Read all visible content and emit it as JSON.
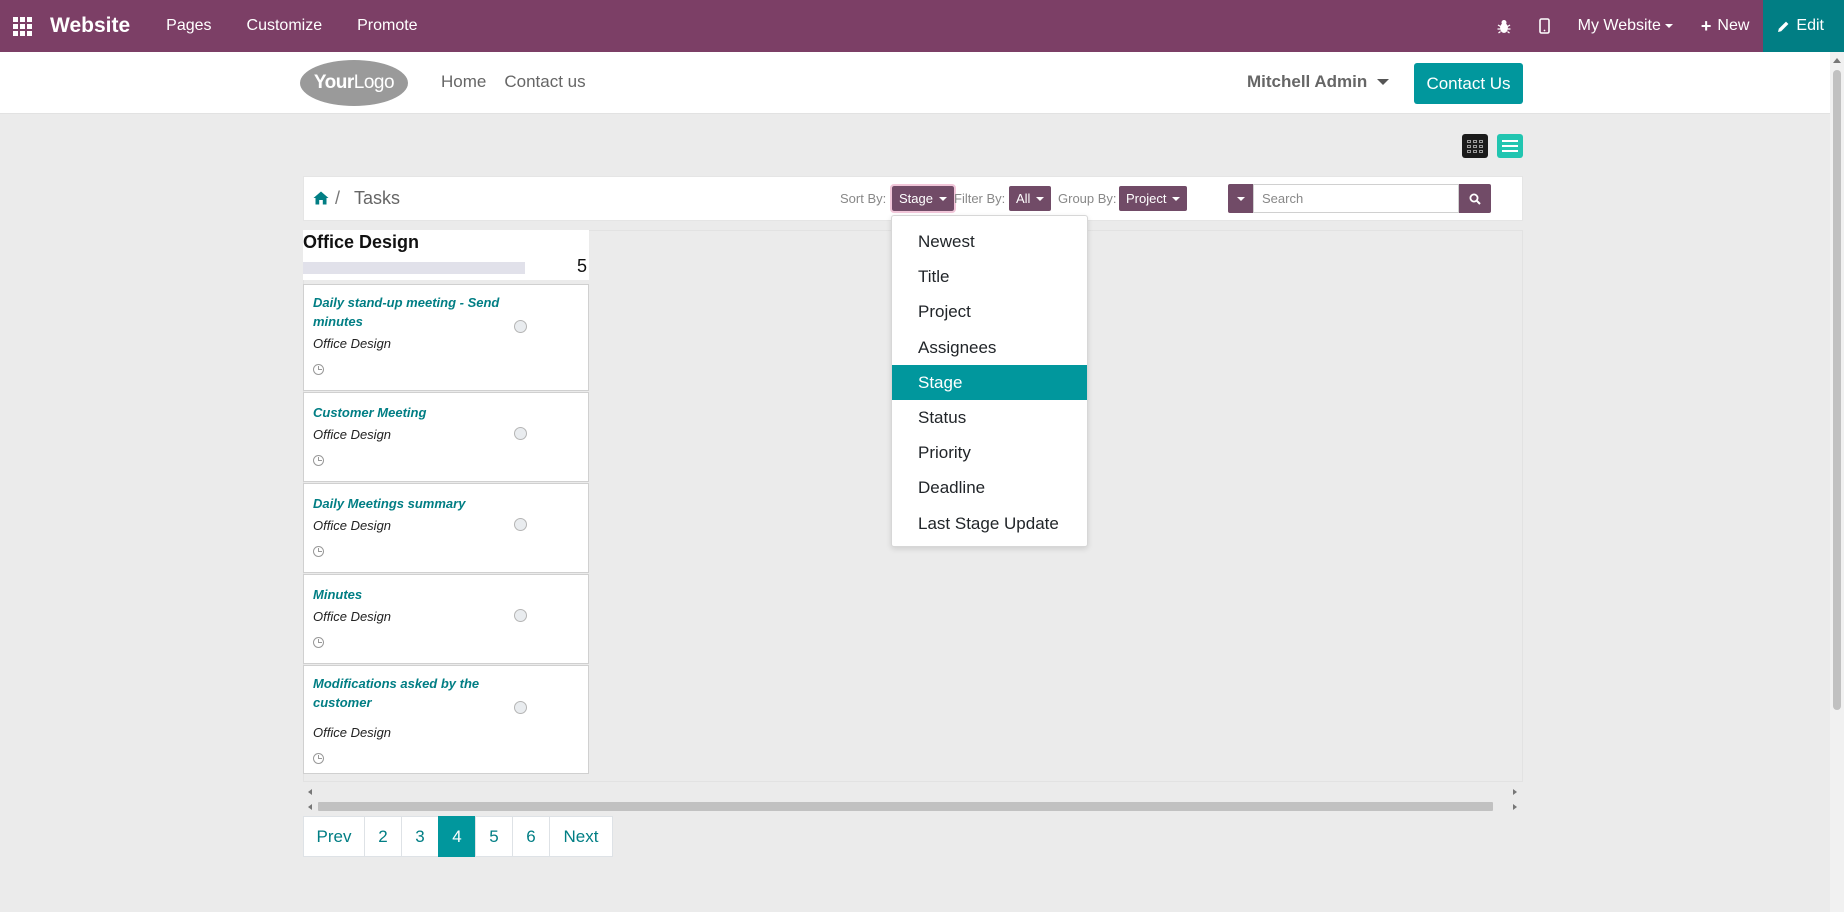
{
  "topbar": {
    "app_name": "Website",
    "menu": [
      "Pages",
      "Customize",
      "Promote"
    ],
    "my_website": "My Website",
    "new_label": "New",
    "edit_label": "Edit",
    "color": "#7c3f66",
    "edit_color": "#017e84"
  },
  "site_header": {
    "logo_text_bold": "Your",
    "logo_text": "Logo",
    "nav": [
      "Home",
      "Contact us"
    ],
    "user": "Mitchell Admin",
    "contact_button": "Contact Us"
  },
  "breadcrumb": {
    "current": "Tasks",
    "separator": "/"
  },
  "controls": {
    "sort_by_label": "Sort By:",
    "sort_by_value": "Stage",
    "filter_by_label": "Filter By:",
    "filter_by_value": "All",
    "group_by_label": "Group By:",
    "group_by_value": "Project",
    "search_placeholder": "Search"
  },
  "sort_dropdown": {
    "options": [
      "Newest",
      "Title",
      "Project",
      "Assignees",
      "Stage",
      "Status",
      "Priority",
      "Deadline",
      "Last Stage Update"
    ],
    "selected": "Stage"
  },
  "kanban": {
    "column_title": "Office Design",
    "column_count": "5",
    "cards": [
      {
        "title": "Daily stand-up meeting - Send minutes",
        "project": "Office Design"
      },
      {
        "title": "Customer Meeting",
        "project": "Office Design"
      },
      {
        "title": "Daily Meetings summary",
        "project": "Office Design"
      },
      {
        "title": "Minutes",
        "project": "Office Design"
      },
      {
        "title": "Modifications asked by the customer",
        "project": "Office Design"
      }
    ]
  },
  "pager": {
    "prev": "Prev",
    "pages": [
      "2",
      "3",
      "4",
      "5",
      "6"
    ],
    "current": "4",
    "next": "Next"
  }
}
